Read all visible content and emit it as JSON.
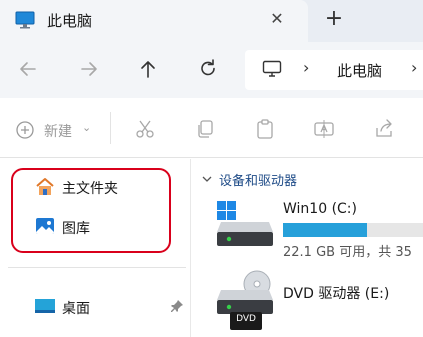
{
  "tab": {
    "title": "此电脑",
    "close_glyph": "✕",
    "new_tab_glyph": "+"
  },
  "nav": {
    "back_icon": "arrow-left-icon",
    "forward_icon": "arrow-right-icon",
    "up_icon": "arrow-up-icon",
    "refresh_icon": "refresh-icon"
  },
  "address": {
    "separator": "›",
    "crumb": "此电脑"
  },
  "toolbar": {
    "new_label": "新建",
    "new_caret": "⌄"
  },
  "sidebar": {
    "items": [
      {
        "label": "主文件夹",
        "icon": "home-icon"
      },
      {
        "label": "图库",
        "icon": "gallery-icon"
      },
      {
        "label": "桌面",
        "icon": "desktop-icon"
      }
    ]
  },
  "content": {
    "group_title": "设备和驱动器",
    "drives": [
      {
        "name": "Win10 (C:)",
        "free_text": "22.1 GB 可用，共 35",
        "used_fraction": 0.6,
        "icon": "windows-drive-icon"
      },
      {
        "name": "DVD 驱动器 (E:)",
        "badge": "DVD",
        "icon": "dvd-drive-icon"
      }
    ]
  },
  "colors": {
    "accent": "#26a0da",
    "highlight_border": "#d9001b",
    "group_header": "#1e4b87"
  }
}
